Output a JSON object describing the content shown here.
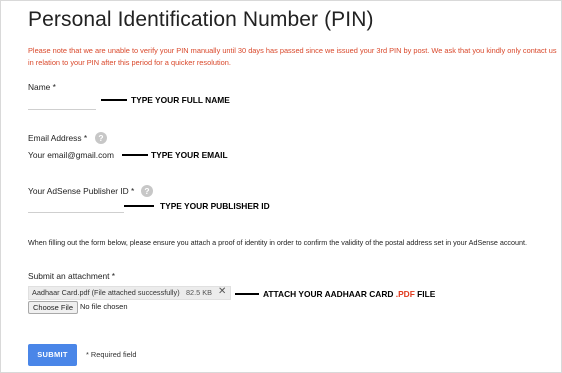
{
  "page": {
    "title": "Personal Identification Number (PIN)",
    "notice": "Please note that we are unable to verify your PIN manually until 30 days has passed since we issued your 3rd PIN by post. We ask that you kindly only contact us in relation to your PIN after this period for a quicker resolution."
  },
  "form": {
    "name_label": "Name *",
    "name_value": "",
    "email_label": "Email Address *",
    "email_value": "Your email@gmail.com",
    "publisher_label": "Your AdSense Publisher ID *",
    "publisher_value": "",
    "help_glyph": "?",
    "info_text": "When filling out the form below, please ensure you attach a proof of identity in order to confirm the validity of the postal address set in your AdSense account.",
    "attachment_label": "Submit an attachment *",
    "attached_file": "Aadhaar Card.pdf (File attached successfully)",
    "attached_size": "82.5 KB",
    "remove_glyph": "✕",
    "choose_file_label": "Choose File",
    "no_file_text": "No file chosen",
    "submit_label": "SUBMIT",
    "required_note": "* Required field"
  },
  "annotations": {
    "name": "TYPE YOUR FULL NAME",
    "email": "TYPE YOUR EMAIL",
    "publisher": "TYPE YOUR PUBLISHER ID",
    "attach_prefix": "ATTACH YOUR AADHAAR CARD ",
    "attach_ext": ".PDF",
    "attach_suffix": " FILE"
  },
  "colors": {
    "notice": "#d9482b",
    "submit": "#4a86e8",
    "pdf_highlight": "#e03a1e"
  }
}
